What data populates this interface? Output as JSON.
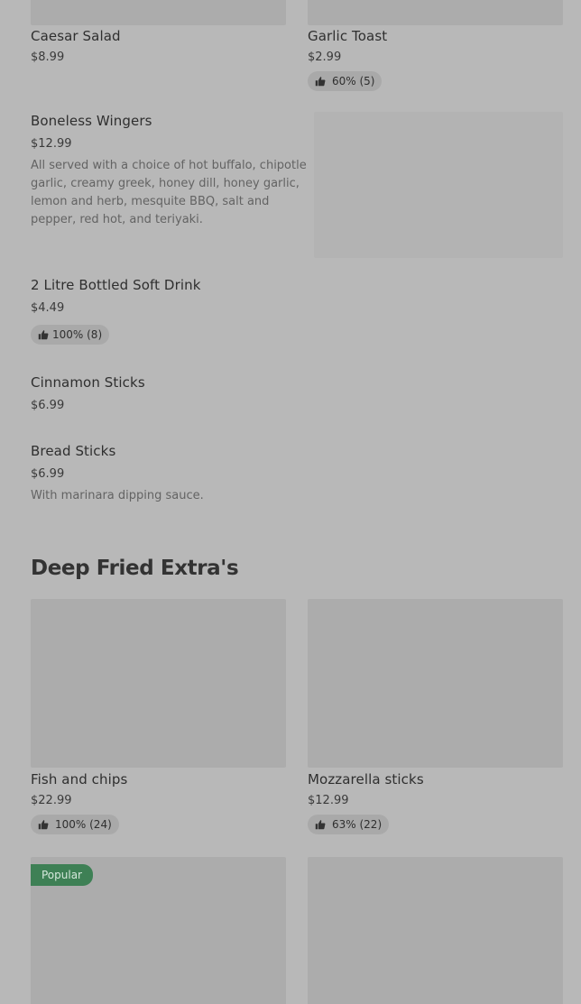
{
  "items_top": [
    {
      "name": "Caesar Salad",
      "price": "$8.99"
    },
    {
      "name": "Garlic Toast",
      "price": "$2.99",
      "rating": "60% (5)"
    }
  ],
  "list_items": [
    {
      "name": "Boneless Wingers",
      "price": "$12.99",
      "description": "All served with a choice of hot buffalo, chipotle garlic, creamy greek, honey dill, honey garlic, lemon and herb, mesquite BBQ, salt and pepper, red hot, and teriyaki."
    },
    {
      "name": "2 Litre Bottled Soft Drink",
      "price": "$4.49",
      "rating": "100% (8)"
    },
    {
      "name": "Cinnamon Sticks",
      "price": "$6.99"
    },
    {
      "name": "Bread Sticks",
      "price": "$6.99",
      "description": "With marinara dipping sauce."
    }
  ],
  "section": {
    "title": "Deep Fried Extra's",
    "cards": [
      {
        "name": "Fish and chips",
        "price": "$22.99",
        "rating": "100% (24)"
      },
      {
        "name": "Mozzarella sticks",
        "price": "$12.99",
        "rating": "63% (22)"
      }
    ],
    "badge": "Popular"
  },
  "icons": {
    "rating": "thumbs-up-icon"
  },
  "colors": {
    "overlay_bg": "#b8b8b8",
    "image_placeholder": "#acacac",
    "pill_bg": "#a9a9a9",
    "popular_badge": "#3e8055"
  }
}
